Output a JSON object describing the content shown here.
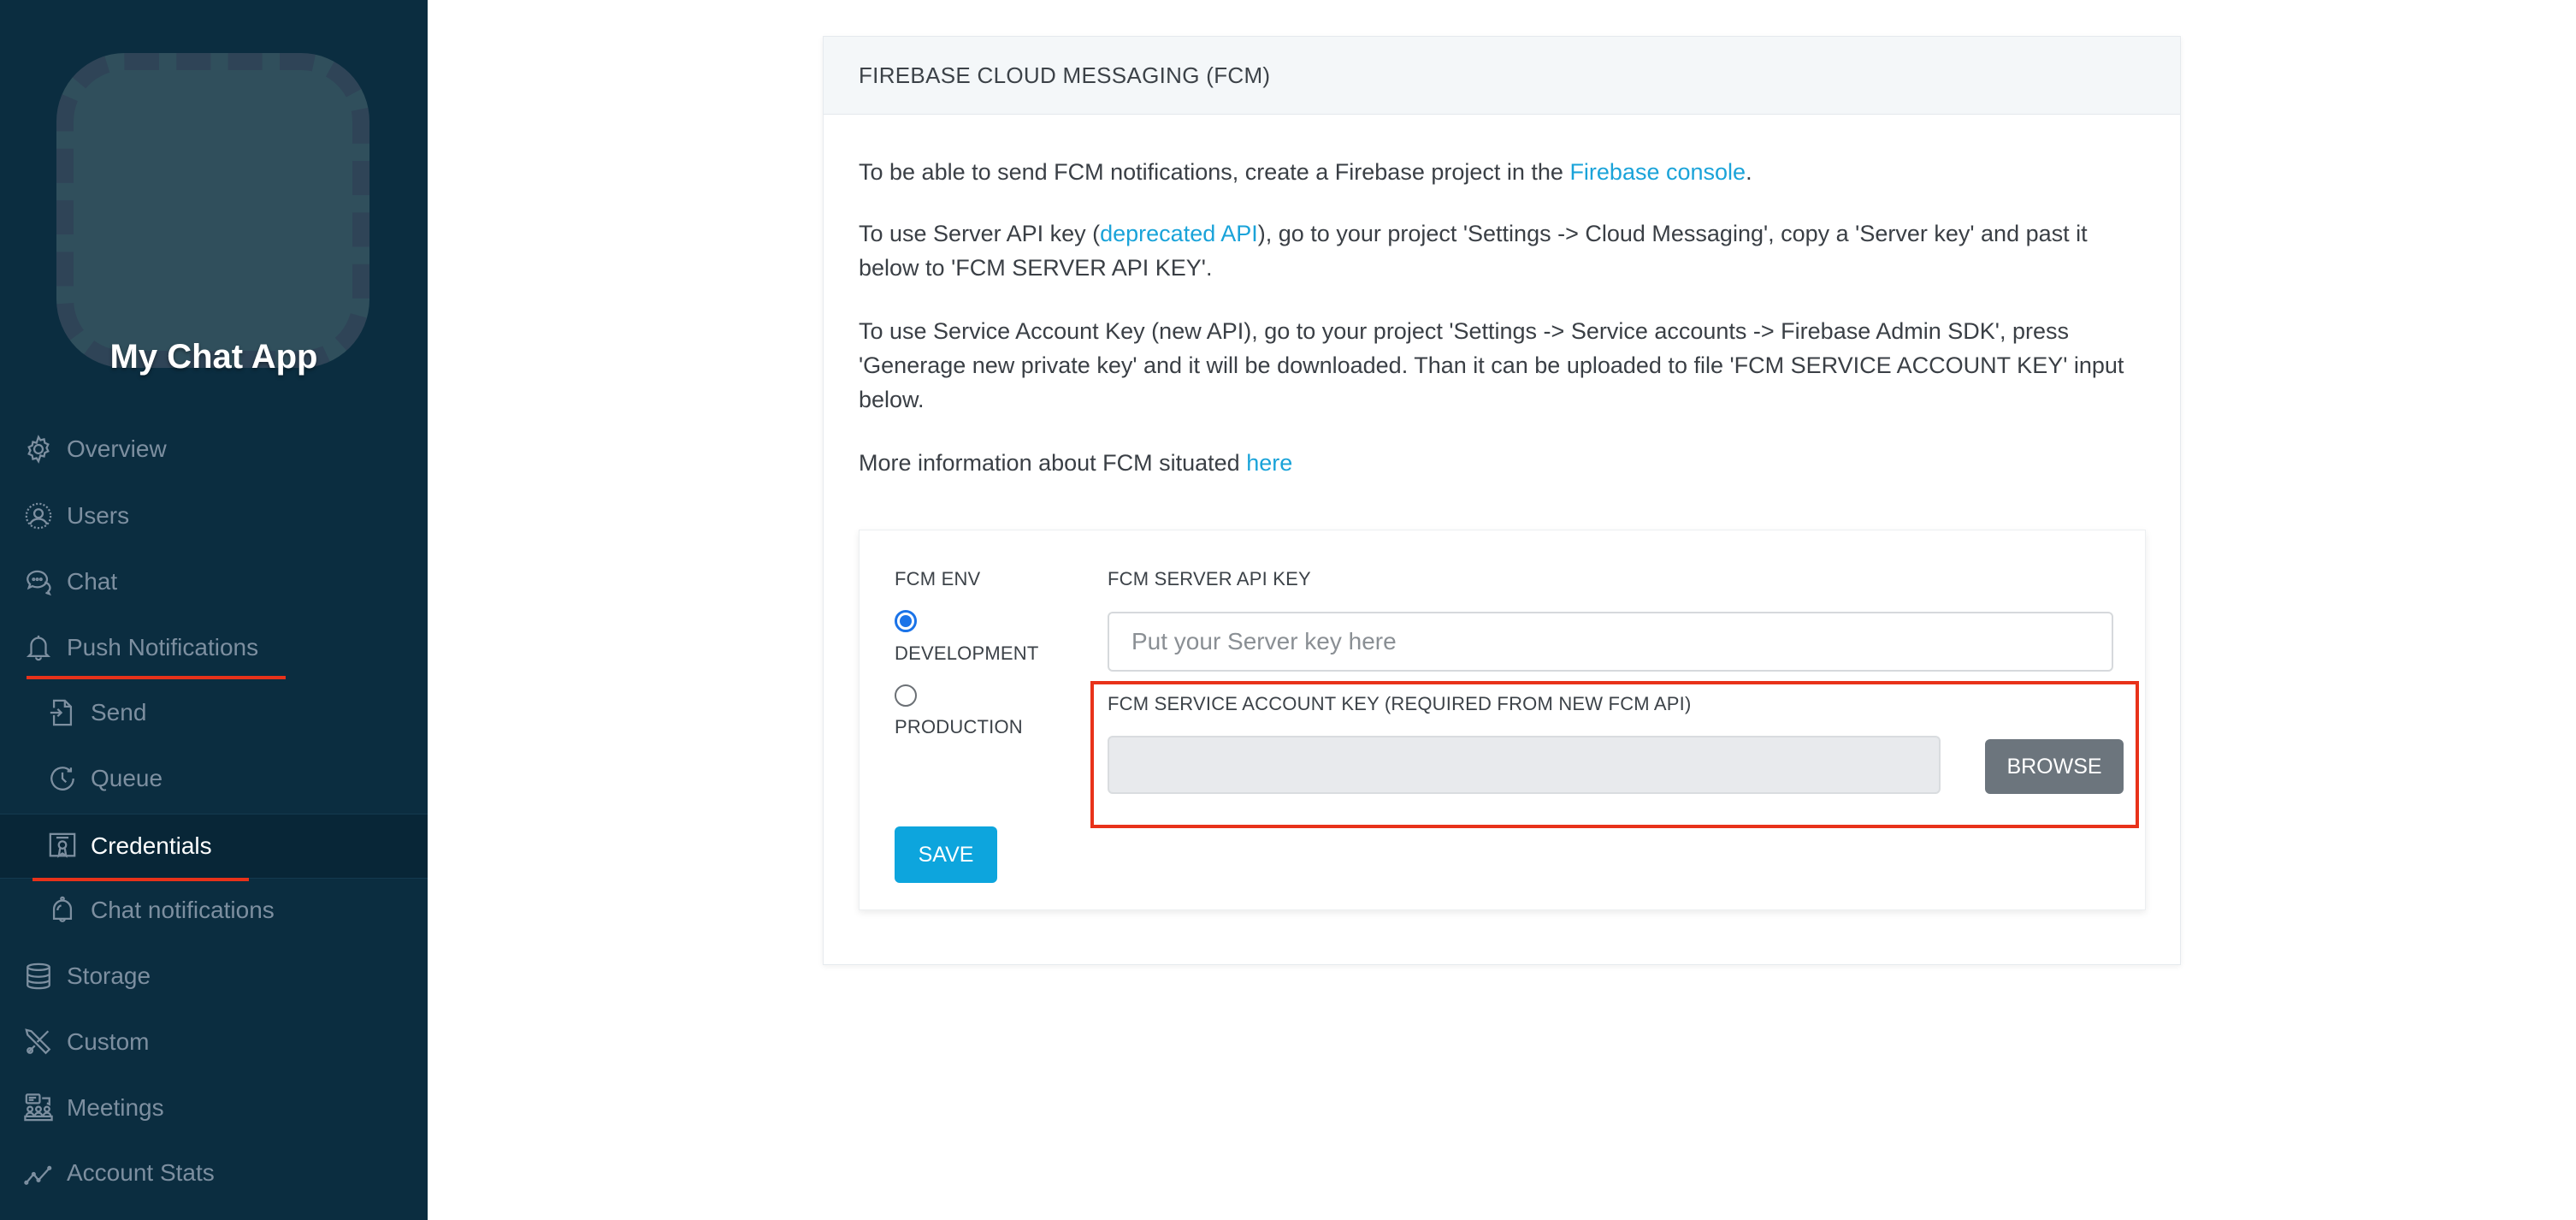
{
  "sidebar": {
    "app_title": "My Chat App",
    "items": [
      {
        "label": "Overview",
        "icon": "gear-icon"
      },
      {
        "label": "Users",
        "icon": "user-icon"
      },
      {
        "label": "Chat",
        "icon": "chat-bubbles-icon"
      },
      {
        "label": "Push Notifications",
        "icon": "bell-icon"
      },
      {
        "label": "Send",
        "icon": "file-import-icon"
      },
      {
        "label": "Queue",
        "icon": "clock-icon"
      },
      {
        "label": "Credentials",
        "icon": "certificate-icon",
        "active": true
      },
      {
        "label": "Chat notifications",
        "icon": "hanging-bell-icon"
      },
      {
        "label": "Storage",
        "icon": "database-icon"
      },
      {
        "label": "Custom",
        "icon": "tools-icon"
      },
      {
        "label": "Meetings",
        "icon": "meeting-icon"
      },
      {
        "label": "Account Stats",
        "icon": "line-chart-icon"
      }
    ],
    "accent_color": "#e8321a"
  },
  "card": {
    "title": "FIREBASE CLOUD MESSAGING (FCM)",
    "p1": {
      "before": "To be able to send FCM notifications, create a Firebase project in the ",
      "link": "Firebase console",
      "after": "."
    },
    "p2": {
      "before": "To use Server API key (",
      "link": "deprecated API",
      "after": "), go to your project 'Settings -> Cloud Messaging', copy a 'Server key' and past it below to 'FCM SERVER API KEY'."
    },
    "p3": "To use Service Account Key (new API), go to your project 'Settings -> Service accounts -> Firebase Admin SDK', press 'Generage new private key' and it will be downloaded. Than it can be uploaded to file 'FCM SERVICE ACCOUNT KEY' input below.",
    "p4": {
      "before": "More information about FCM situated ",
      "link": "here"
    }
  },
  "form": {
    "env_label": "FCM ENV",
    "env_options": [
      {
        "label": "DEVELOPMENT",
        "checked": true
      },
      {
        "label": "PRODUCTION",
        "checked": false
      }
    ],
    "server_key_label": "FCM SERVER API KEY",
    "server_key_value": "",
    "server_key_placeholder": "Put your Server key here",
    "service_account_label": "FCM SERVICE ACCOUNT KEY (REQUIRED FROM NEW FCM API)",
    "browse_label": "BROWSE",
    "save_label": "SAVE"
  }
}
